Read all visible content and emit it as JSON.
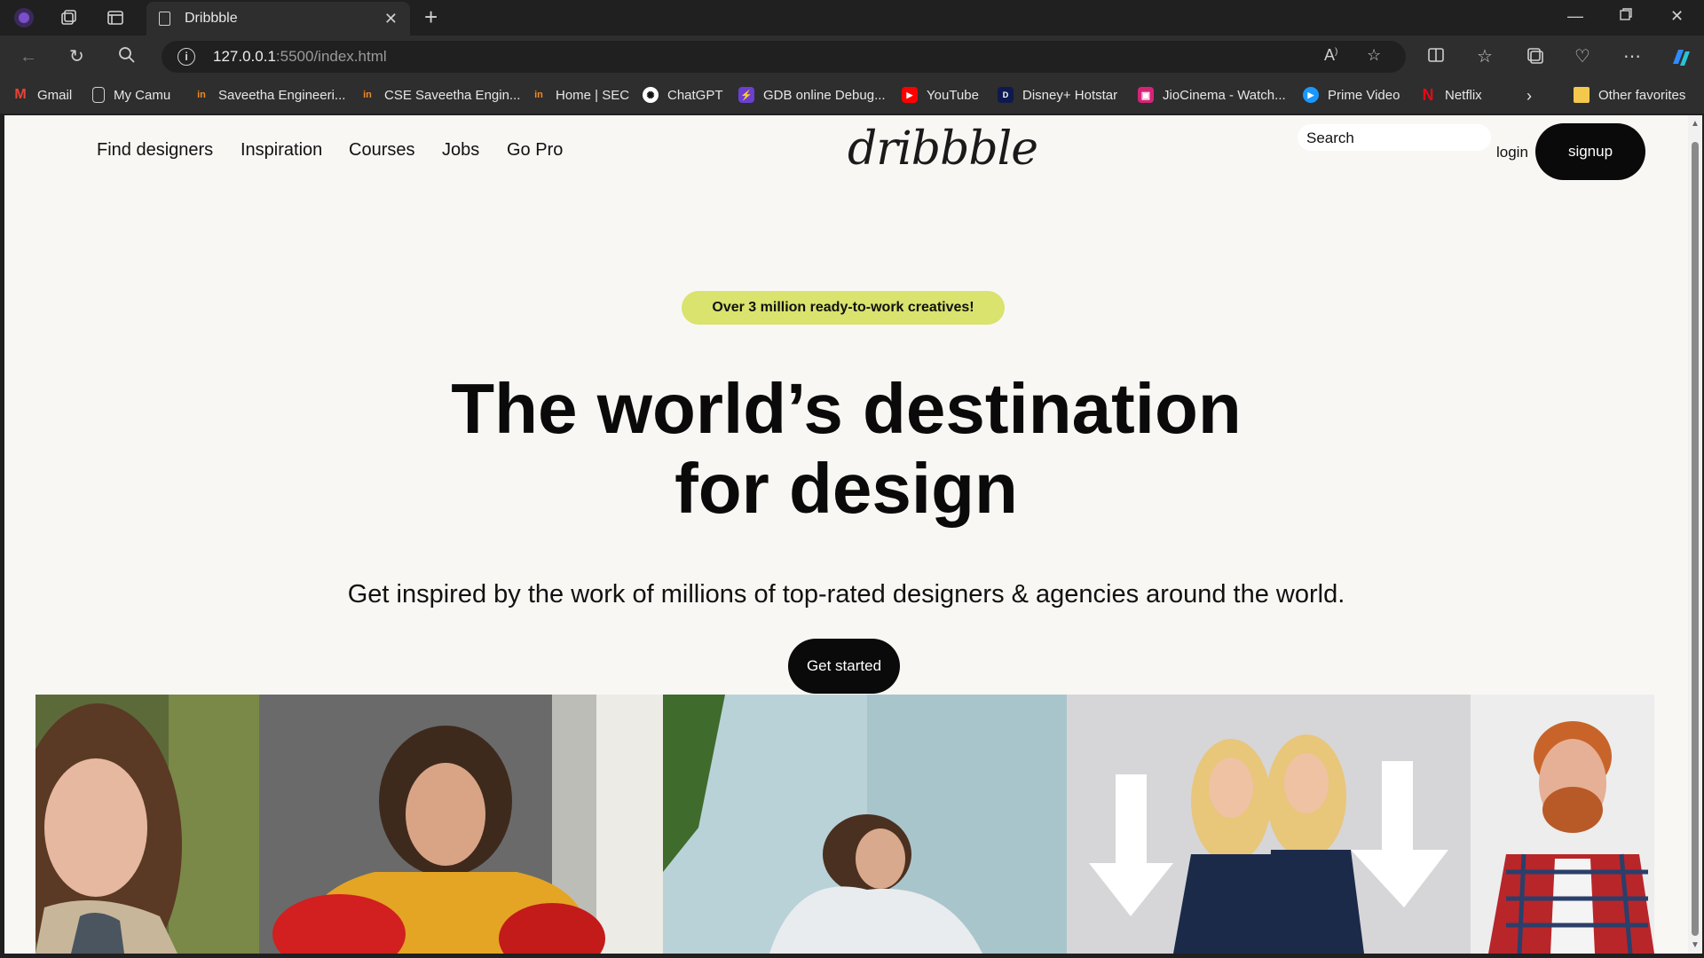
{
  "browser": {
    "tab_title": "Dribbble",
    "url_host": "127.0.0.1",
    "url_path": ":5500/index.html",
    "bookmarks": [
      {
        "label": "Gmail",
        "icon": "gmail-icon",
        "color": "#ea4335"
      },
      {
        "label": "My Camu",
        "icon": "document-icon",
        "color": "#2e2e2e"
      },
      {
        "label": "Saveetha Engineeri...",
        "icon": "saveetha-icon",
        "color": "#f08a24"
      },
      {
        "label": "CSE Saveetha Engin...",
        "icon": "saveetha-icon",
        "color": "#f08a24"
      },
      {
        "label": "Home | SEC",
        "icon": "saveetha-icon",
        "color": "#f08a24"
      },
      {
        "label": "ChatGPT",
        "icon": "chatgpt-icon",
        "color": "#444444"
      },
      {
        "label": "GDB online Debug...",
        "icon": "gdb-icon",
        "color": "#6b3fd1"
      },
      {
        "label": "YouTube",
        "icon": "youtube-icon",
        "color": "#ff0000"
      },
      {
        "label": "Disney+ Hotstar",
        "icon": "hotstar-icon",
        "color": "#0e1a4f"
      },
      {
        "label": "JioCinema - Watch...",
        "icon": "jiocinema-icon",
        "color": "#d6237a"
      },
      {
        "label": "Prime Video",
        "icon": "prime-video-icon",
        "color": "#1a98ff"
      },
      {
        "label": "Netflix",
        "icon": "netflix-icon",
        "color": "#e50914"
      }
    ],
    "other_favorites": "Other favorites"
  },
  "site": {
    "nav": [
      "Find designers",
      "Inspiration",
      "Courses",
      "Jobs",
      "Go Pro"
    ],
    "logo": "dribbble",
    "search_placeholder": "Search",
    "login": "login",
    "signup": "signup",
    "pill": "Over 3 million ready-to-work creatives!",
    "headline_line1": "The world’s destination",
    "headline_line2": "for design",
    "subtitle": "Get inspired by the work of millions of top-rated designers & agencies around the world.",
    "cta": "Get started"
  }
}
